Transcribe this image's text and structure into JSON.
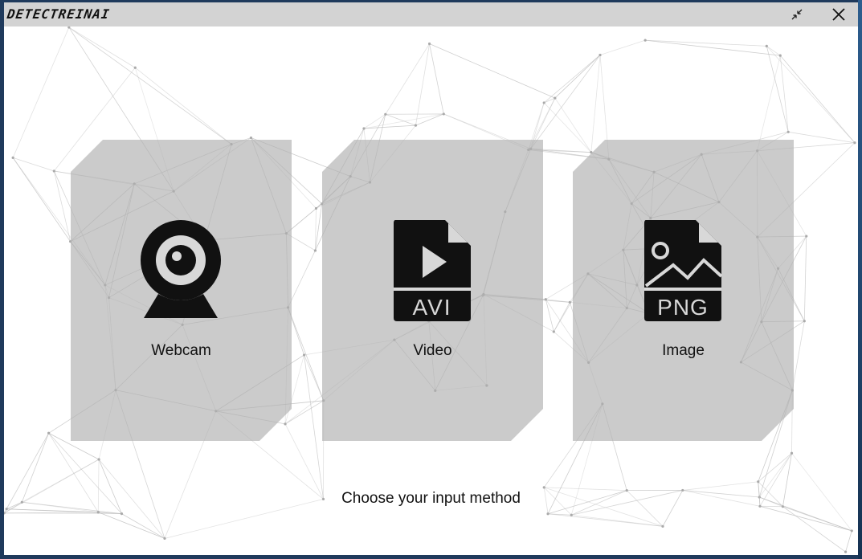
{
  "app": {
    "title": "DETECTREINAI"
  },
  "window_controls": {
    "shrink_icon": "shrink-arrows-icon",
    "close_icon": "close-icon"
  },
  "options": [
    {
      "label": "Webcam",
      "icon": "webcam-icon"
    },
    {
      "label": "Video",
      "icon": "video-file-icon",
      "badge": "AVI"
    },
    {
      "label": "Image",
      "icon": "image-file-icon",
      "badge": "PNG"
    }
  ],
  "prompt": "Choose your input method",
  "colors": {
    "titlebar": "#d3d3d3",
    "card": "#afafaf",
    "mesh_line": "#bdbdbd",
    "icon": "#111111"
  }
}
